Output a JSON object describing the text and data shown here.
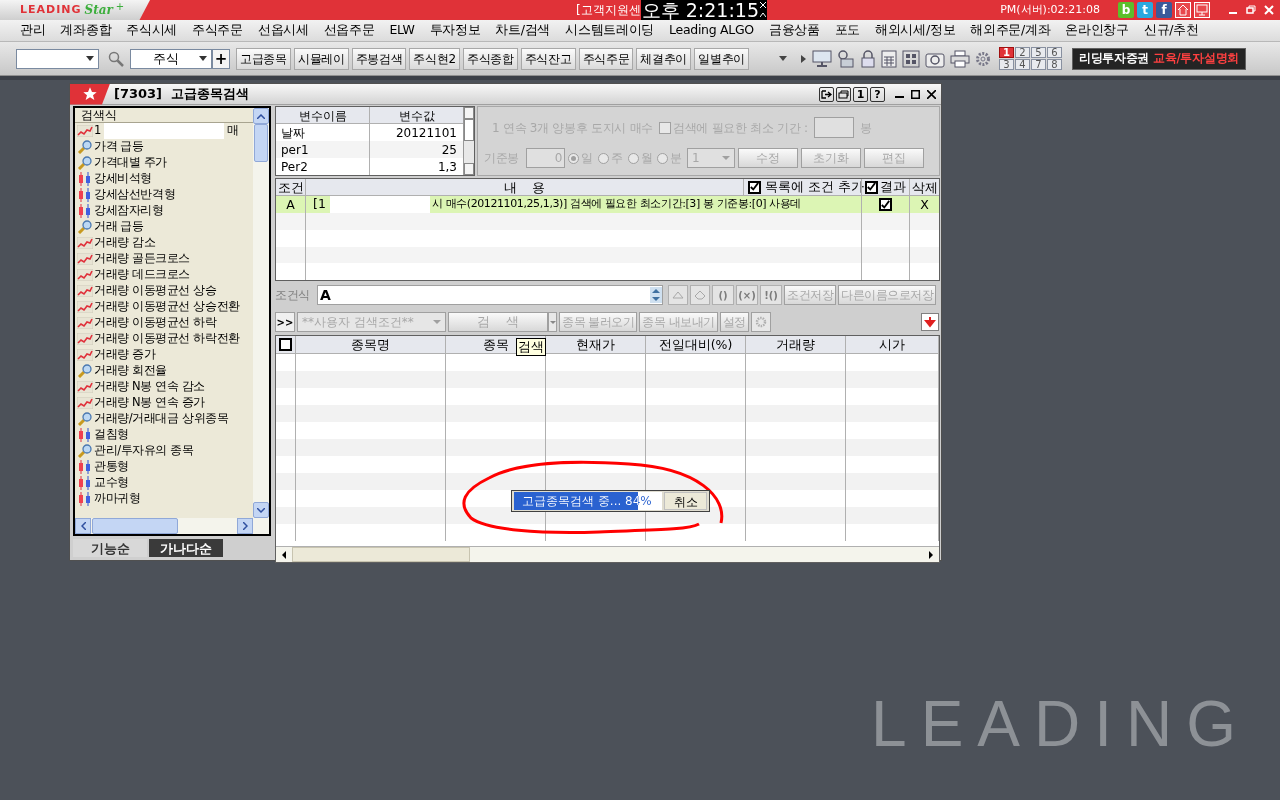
{
  "title_bar": {
    "logo": "LEADING",
    "logo_sub": "Star",
    "logo_plus": "+",
    "notice": "[고객지원센",
    "clock": "오후 2:21:15",
    "server_time": "PM(서버):02:21:08",
    "social": [
      "b",
      "t",
      "f"
    ]
  },
  "menu": [
    "관리",
    "계좌종합",
    "주식시세",
    "주식주문",
    "선옵시세",
    "선옵주문",
    "ELW",
    "투자정보",
    "차트/검색",
    "시스템트레이딩",
    "Leading ALGO",
    "금융상품",
    "포도",
    "해외시세/정보",
    "해외주문/계좌",
    "온라인창구",
    "신규/추천"
  ],
  "toolbar": {
    "market_combo": "주식",
    "add": "+",
    "buttons": [
      "고급종목",
      "시뮬레이",
      "주봉검색",
      "주식현2",
      "주식종합",
      "주식잔고",
      "주식주문",
      "체결추이",
      "일별추이"
    ],
    "screens": [
      {
        "label": "1",
        "selected": true
      },
      {
        "label": "2",
        "selected": false
      },
      {
        "label": "5",
        "selected": false
      },
      {
        "label": "6",
        "selected": false
      },
      {
        "label": "3",
        "selected": false
      },
      {
        "label": "4",
        "selected": false
      },
      {
        "label": "7",
        "selected": false
      },
      {
        "label": "8",
        "selected": false
      }
    ],
    "banner": {
      "company": "리딩투자증권",
      "link": "교육/투자설명회"
    }
  },
  "window": {
    "title": "[7303]  고급종목검색",
    "number_button": "1",
    "help_button": "?",
    "formula_list": {
      "header": "검색식",
      "items": [
        {
          "kind": "chart",
          "label": "1",
          "suffix": "매"
        },
        {
          "kind": "search",
          "label": "가격 급등"
        },
        {
          "kind": "search",
          "label": "가격대별 주가"
        },
        {
          "kind": "candle",
          "label": "강세비석형"
        },
        {
          "kind": "candle",
          "label": "강세삼선반격형"
        },
        {
          "kind": "candle",
          "label": "강세잠자리형"
        },
        {
          "kind": "search",
          "label": "거래 급등"
        },
        {
          "kind": "chart",
          "label": "거래량 감소"
        },
        {
          "kind": "chart",
          "label": "거래량 골든크로스"
        },
        {
          "kind": "chart",
          "label": "거래량 데드크로스"
        },
        {
          "kind": "chart",
          "label": "거래량 이동평균선 상승"
        },
        {
          "kind": "chart",
          "label": "거래량 이동평균선 상승전환"
        },
        {
          "kind": "chart",
          "label": "거래량 이동평균선 하락"
        },
        {
          "kind": "chart",
          "label": "거래량 이동평균선 하락전환"
        },
        {
          "kind": "chart",
          "label": "거래량 증가"
        },
        {
          "kind": "search",
          "label": "거래량 회전율"
        },
        {
          "kind": "chart",
          "label": "거래량 N봉 연속 감소"
        },
        {
          "kind": "chart",
          "label": "거래량 N봉 연속 증가"
        },
        {
          "kind": "search",
          "label": "거래량/거래대금 상위종목"
        },
        {
          "kind": "candle",
          "label": "걸침형"
        },
        {
          "kind": "search",
          "label": "관리/투자유의 종목"
        },
        {
          "kind": "candle",
          "label": "관통형"
        },
        {
          "kind": "candle",
          "label": "교수형"
        },
        {
          "kind": "candle",
          "label": "까마귀형"
        }
      ]
    },
    "sort_tabs": [
      {
        "label": "기능순",
        "selected": false
      },
      {
        "label": "가나다순",
        "selected": true
      }
    ],
    "variables": {
      "columns": [
        "변수이름",
        "변수값"
      ],
      "rows": [
        [
          "날짜",
          "20121101"
        ],
        [
          "per1",
          "25"
        ],
        [
          "Per2",
          "1,3"
        ]
      ]
    },
    "condition_detail": {
      "disabled": true,
      "description": "1 연속 3개 양봉후 도지시 매수",
      "min_period": {
        "label": "검색에 필요한 최소 기간 :",
        "checked": false
      },
      "unit": "봉",
      "base_label": "기준봉",
      "base_value": "0",
      "periods": [
        {
          "label": "일",
          "selected": true
        },
        {
          "label": "주",
          "selected": false
        },
        {
          "label": "월",
          "selected": false
        },
        {
          "label": "분",
          "selected": false
        }
      ],
      "period_select": "1",
      "buttons": [
        "수정",
        "초기화",
        "편집"
      ]
    },
    "conditions": {
      "col_cond": "조건",
      "col_content": "내    용",
      "col_add": {
        "label": "목록에 조건 추가",
        "checked": true
      },
      "col_result": {
        "label": "결과",
        "checked": true
      },
      "col_delete": "삭제",
      "rows": [
        {
          "cond": "A",
          "prefix": "[1",
          "text": "시 매수(20121101,25,1,3)] 검색에 필요한 최소기간:[3] 봉  기준봉:[0] 사용데",
          "result": true,
          "delete": "X",
          "selected": true
        }
      ]
    },
    "formula": {
      "label": "조건식",
      "value": "A",
      "disabled": true,
      "ops": [
        "()",
        "(×)",
        "!()"
      ],
      "buttons": [
        "조건저장",
        "다른이름으로저장"
      ]
    },
    "search_bar": {
      "expand": ">>",
      "user_select": "**사용자 검색조건**",
      "search": "검    색",
      "disabled": true,
      "buttons": [
        "종목 불러오기",
        "종목 내보내기",
        "설정"
      ]
    },
    "results": {
      "select_all": {
        "checked": false
      },
      "columns": [
        "종목명",
        "종목",
        "현재가",
        "전일대비(%)",
        "거래량",
        "시가"
      ],
      "tooltip": "검색"
    },
    "progress": {
      "label": "고급종목검색 중... 84%",
      "level": 0.84,
      "cancel": "취소"
    }
  },
  "background_logo": "LEADING"
}
